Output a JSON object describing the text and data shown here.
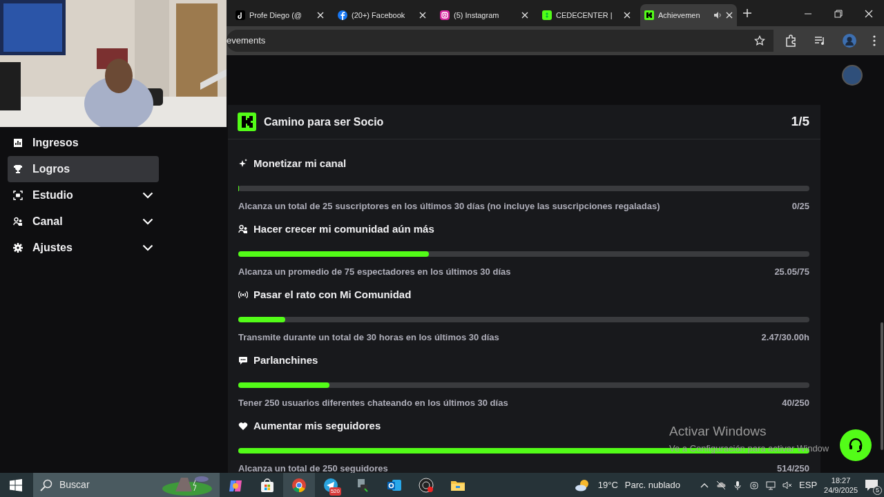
{
  "browser": {
    "tabs": [
      {
        "title": "Profe Diego (@",
        "selected": false,
        "audio": false
      },
      {
        "title": "(20+) Facebook",
        "selected": false,
        "audio": false
      },
      {
        "title": "(5) Instagram",
        "selected": false,
        "audio": false
      },
      {
        "title": "CEDECENTER |",
        "selected": false,
        "audio": false
      },
      {
        "title": "Achievemen",
        "selected": true,
        "audio": true
      }
    ],
    "address": "evements"
  },
  "sidebar": {
    "items": [
      {
        "label": "Ingresos",
        "selected": false,
        "expandable": false
      },
      {
        "label": "Logros",
        "selected": true,
        "expandable": false
      },
      {
        "label": "Estudio",
        "selected": false,
        "expandable": true
      },
      {
        "label": "Canal",
        "selected": false,
        "expandable": true
      },
      {
        "label": "Ajustes",
        "selected": false,
        "expandable": true
      }
    ]
  },
  "card": {
    "title": "Camino para ser Socio",
    "count": "1/5",
    "goals": [
      {
        "title": "Monetizar mi canal",
        "description": "Alcanza un total de 25 suscriptores en los últimos 30 días (no incluye las suscripciones regaladas)",
        "reading": "0/25",
        "level": 0
      },
      {
        "title": "Hacer crecer mi comunidad aún más",
        "description": "Alcanza un promedio de 75 espectadores en los últimos 30 días",
        "reading": "25.05/75",
        "level": 0.334
      },
      {
        "title": "Pasar el rato con Mi Comunidad",
        "description": "Transmite durante un total de 30 horas en los últimos 30 días",
        "reading": "2.47/30.00h",
        "level": 0.082
      },
      {
        "title": "Parlanchines",
        "description": "Tener 250 usuarios diferentes chateando en los últimos 30 días",
        "reading": "40/250",
        "level": 0.16
      },
      {
        "title": "Aumentar mis seguidores",
        "description": "Alcanza un total de 250 seguidores",
        "reading": "514/250",
        "level": 1
      }
    ]
  },
  "activation_notice": {
    "title": "Activar Windows",
    "text": "Ve a Configuración para activar Window"
  },
  "taskbar": {
    "search_placeholder": "Buscar",
    "telegram_badge": "520",
    "temperature": "19°C",
    "weather": "Parc. nublado",
    "language": "ESP",
    "time": "18:27",
    "date": "24/9/2025",
    "notifications": "5"
  }
}
